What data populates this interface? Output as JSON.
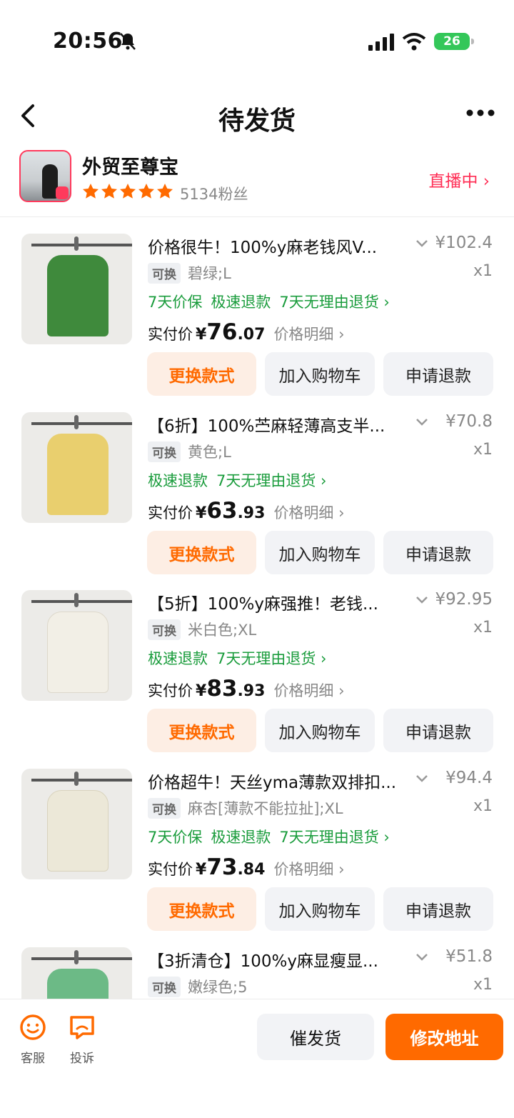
{
  "status_bar": {
    "time": "20:56",
    "battery": "26"
  },
  "header": {
    "title": "待发货"
  },
  "shop": {
    "name": "外贸至尊宝",
    "fans": "5134粉丝",
    "live": "直播中 ›"
  },
  "items": [
    {
      "name": "价格很牛！100%y麻老钱风V...",
      "price": "¥102.4",
      "qty": "x1",
      "tag": "可换",
      "sku": "碧绿;L",
      "services": [
        "7天价保",
        "极速退款",
        "7天无理由退货 ›"
      ],
      "paid_label": "实付价",
      "paid_yen": "¥",
      "paid_int": "76",
      "paid_dec": ".07",
      "detail": "价格明细 ›",
      "btn_change": "更换款式",
      "btn_cart": "加入购物车",
      "btn_refund": "申请退款",
      "color": "#3f8a3c"
    },
    {
      "name": "【6折】100%苎麻轻薄高支半...",
      "price": "¥70.8",
      "qty": "x1",
      "tag": "可换",
      "sku": "黄色;L",
      "services": [
        "极速退款",
        "7天无理由退货 ›"
      ],
      "paid_label": "实付价",
      "paid_yen": "¥",
      "paid_int": "63",
      "paid_dec": ".93",
      "detail": "价格明细 ›",
      "btn_change": "更换款式",
      "btn_cart": "加入购物车",
      "btn_refund": "申请退款",
      "color": "#e9cf6e"
    },
    {
      "name": "【5折】100%y麻强推！老钱...",
      "price": "¥92.95",
      "qty": "x1",
      "tag": "可换",
      "sku": "米白色;XL",
      "services": [
        "极速退款",
        "7天无理由退货 ›"
      ],
      "paid_label": "实付价",
      "paid_yen": "¥",
      "paid_int": "83",
      "paid_dec": ".93",
      "detail": "价格明细 ›",
      "btn_change": "更换款式",
      "btn_cart": "加入购物车",
      "btn_refund": "申请退款",
      "color": "#f2efe6"
    },
    {
      "name": "价格超牛！天丝yma薄款双排扣...",
      "price": "¥94.4",
      "qty": "x1",
      "tag": "可换",
      "sku": "麻杏[薄款不能拉扯];XL",
      "services": [
        "7天价保",
        "极速退款",
        "7天无理由退货 ›"
      ],
      "paid_label": "实付价",
      "paid_yen": "¥",
      "paid_int": "73",
      "paid_dec": ".84",
      "detail": "价格明细 ›",
      "btn_change": "更换款式",
      "btn_cart": "加入购物车",
      "btn_refund": "申请退款",
      "color": "#ece8d8"
    },
    {
      "name": "【3折清仓】100%y麻显瘦显...",
      "price": "¥51.8",
      "qty": "x1",
      "tag": "可换",
      "sku": "嫩绿色;5",
      "services": [],
      "color": "#6cba86"
    }
  ],
  "bottom": {
    "service_label": "客服",
    "complaint_label": "投诉",
    "urge_label": "催发货",
    "address_label": "修改地址"
  },
  "colors": {
    "accent_orange": "#ff6a00",
    "service_green": "#1a9c3c",
    "live_red": "#ff2e55"
  }
}
